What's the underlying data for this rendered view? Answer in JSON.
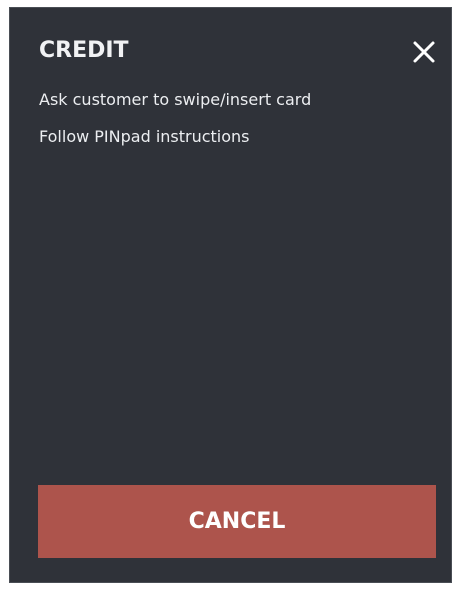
{
  "dialog": {
    "title": "CREDIT",
    "close_icon": "close-icon",
    "instructions": [
      "Ask customer to swipe/insert card",
      "Follow PINpad instructions"
    ],
    "cancel_label": "CANCEL"
  },
  "colors": {
    "background": "#2f3239",
    "text": "#f1f2f4",
    "cancel_button": "#ad544c"
  }
}
